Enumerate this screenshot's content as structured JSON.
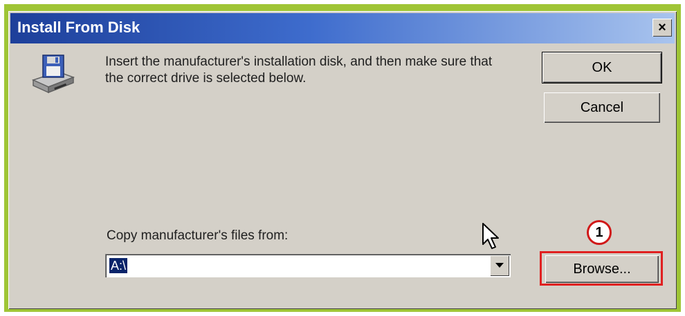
{
  "dialog": {
    "title": "Install From Disk",
    "close_glyph": "✕",
    "message": "Insert the manufacturer's installation disk, and then make sure that the correct drive is selected below.",
    "ok_label": "OK",
    "cancel_label": "Cancel",
    "copy_label": "Copy manufacturer's files from:",
    "path_value": "A:\\",
    "browse_label": "Browse...",
    "annotation_number": "1",
    "icons": {
      "disk": "floppy-drive-icon",
      "dropdown": "chevron-down-icon",
      "cursor": "mouse-pointer-icon"
    },
    "colors": {
      "titlebar_start": "#1d3f9a",
      "titlebar_end": "#a9c4ee",
      "window_face": "#d4d0c8",
      "highlight_red": "#e02020",
      "outer_frame": "#9fc536",
      "selection": "#0a246a"
    }
  }
}
